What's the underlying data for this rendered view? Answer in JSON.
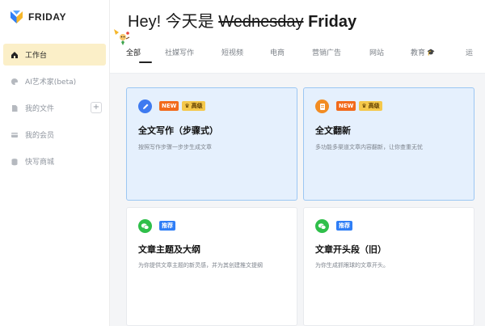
{
  "logo": {
    "text": "FRIDAY"
  },
  "sidebar": {
    "items": [
      {
        "label": "工作台",
        "icon": "home-icon",
        "active": true
      },
      {
        "label": "AI艺术家(beta)",
        "icon": "palette-icon",
        "active": false
      },
      {
        "label": "我的文件",
        "icon": "file-icon",
        "active": false,
        "plus": "+"
      },
      {
        "label": "我的会员",
        "icon": "membership-card-icon",
        "active": false
      },
      {
        "label": "快写商城",
        "icon": "store-icon",
        "active": false
      }
    ]
  },
  "header": {
    "greeting_prefix": "Hey! 今天是",
    "greeting_strike": "Wednesday",
    "greeting_day": "Friday"
  },
  "tabs": [
    {
      "label": "全部",
      "active": true
    },
    {
      "label": "社媒写作"
    },
    {
      "label": "短视频"
    },
    {
      "label": "电商"
    },
    {
      "label": "营销广告"
    },
    {
      "label": "网站"
    },
    {
      "label": "教育",
      "hat": "🎓"
    },
    {
      "label": "运"
    }
  ],
  "cards": [
    {
      "title": "全文写作（步骤式）",
      "desc": "按照写作步骤一步步生成文章",
      "badges": [
        "NEW",
        "高级"
      ],
      "icon": "pen-icon",
      "icon_color": "#3e7af0"
    },
    {
      "title": "全文翻新",
      "desc": "多功能多渠道文章内容翻新，让你查重无忧",
      "badges": [
        "NEW",
        "高级"
      ],
      "icon": "document-icon",
      "icon_color": "#f28c22"
    },
    {
      "title": "文章主题及大纲",
      "desc": "为你提供文章主题的新灵感，并为其创建推文提纲",
      "badges": [
        "推荐"
      ],
      "icon": "wechat-icon",
      "icon_color": "#2fbf4a"
    },
    {
      "title": "文章开头段（旧）",
      "desc": "为你生成抓眼球的文章开头。",
      "badges": [
        "推荐"
      ],
      "icon": "wechat-icon",
      "icon_color": "#2fbf4a"
    }
  ],
  "colors": {
    "accent": "#fbefc8",
    "highlight_bg": "#e5f0fd",
    "highlight_border": "#9cc7f3",
    "new_badge": "#f26a1b",
    "pro_badge": "#f5c84a",
    "recommend_badge": "#2f7ef6"
  }
}
